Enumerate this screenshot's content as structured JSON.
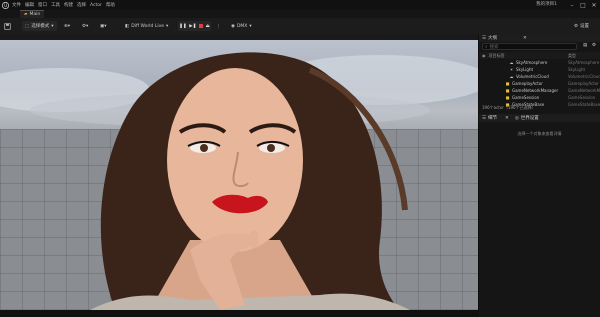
{
  "menubar": {
    "items": [
      "文件",
      "编辑",
      "窗口",
      "工具",
      "构建",
      "选择",
      "Actor",
      "帮助"
    ],
    "project_name": "我的项目1"
  },
  "tab": {
    "label": "Main"
  },
  "toolbar": {
    "mode_label": "选择模式",
    "net_mode_label": "Diff World Live",
    "platform_label": "DMX",
    "settings_label": "设置"
  },
  "outliner": {
    "title": "大纲",
    "search_placeholder": "搜索",
    "col_label": "项目标签",
    "col_type": "类型",
    "rows": [
      {
        "label": "SkyAtmosphere",
        "type": "SkyAtmosphere"
      },
      {
        "label": "SkyLight",
        "type": "SkyLight"
      },
      {
        "label": "VolumetricCloud",
        "type": "VolumetricCloud"
      },
      {
        "label": "GameplayActor",
        "type": "GameplayActor"
      },
      {
        "label": "GameNetworkManager",
        "type": "GameNetworkManager"
      },
      {
        "label": "GameSession",
        "type": "GameSession"
      },
      {
        "label": "GameStateBase",
        "type": "GameStateBase"
      }
    ],
    "status": "196个actor（196个已选择）"
  },
  "details": {
    "tabs": [
      "细节",
      "世界设置"
    ],
    "empty_text": "选择一个对象来查看详情"
  }
}
